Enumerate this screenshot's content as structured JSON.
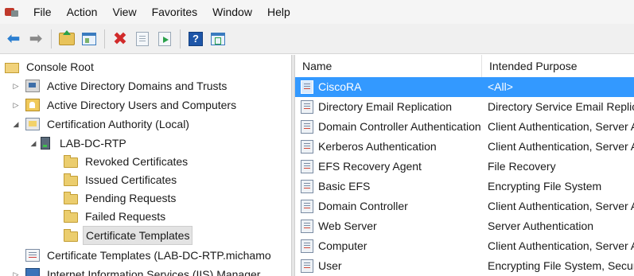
{
  "menu": [
    "File",
    "Action",
    "View",
    "Favorites",
    "Window",
    "Help"
  ],
  "toolbar": {
    "buttons": [
      "back-icon",
      "forward-icon",
      "up-folder-icon",
      "show-hide-tree-icon",
      "delete-icon",
      "properties-sheet-icon",
      "export-list-icon",
      "help-icon",
      "action-pane-icon"
    ],
    "help_glyph": "?"
  },
  "tree": {
    "items": [
      {
        "label": "Console Root",
        "icon": "folder-icon",
        "expander": ""
      },
      {
        "label": "Active Directory Domains and Trusts",
        "icon": "ad-domains-icon",
        "expander": "▷"
      },
      {
        "label": "Active Directory Users and Computers",
        "icon": "ad-users-icon",
        "expander": "▷"
      },
      {
        "label": "Certification Authority (Local)",
        "icon": "ca-icon",
        "expander": "◢"
      },
      {
        "label": "LAB-DC-RTP",
        "icon": "server-icon",
        "expander": "◢"
      },
      {
        "label": "Revoked Certificates",
        "icon": "folder-icon",
        "expander": ""
      },
      {
        "label": "Issued Certificates",
        "icon": "folder-icon",
        "expander": ""
      },
      {
        "label": "Pending Requests",
        "icon": "folder-icon",
        "expander": ""
      },
      {
        "label": "Failed Requests",
        "icon": "folder-icon",
        "expander": ""
      },
      {
        "label": "Certificate Templates",
        "icon": "folder-icon",
        "expander": ""
      },
      {
        "label": "Certificate Templates (LAB-DC-RTP.michamo",
        "icon": "cert-templates-icon",
        "expander": ""
      },
      {
        "label": "Internet Information Services (IIS) Manager",
        "icon": "iis-icon",
        "expander": "▷"
      }
    ],
    "selected": "Certificate Templates"
  },
  "list": {
    "columns": [
      "Name",
      "Intended Purpose"
    ],
    "rows": [
      {
        "name": "CiscoRA",
        "purpose": "<All>"
      },
      {
        "name": "Directory Email Replication",
        "purpose": "Directory Service Email Replication"
      },
      {
        "name": "Domain Controller Authentication",
        "purpose": "Client Authentication, Server Authentication"
      },
      {
        "name": "Kerberos Authentication",
        "purpose": "Client Authentication, Server Authentication"
      },
      {
        "name": "EFS Recovery Agent",
        "purpose": "File Recovery"
      },
      {
        "name": "Basic EFS",
        "purpose": "Encrypting File System"
      },
      {
        "name": "Domain Controller",
        "purpose": "Client Authentication, Server Authentication"
      },
      {
        "name": "Web Server",
        "purpose": "Server Authentication"
      },
      {
        "name": "Computer",
        "purpose": "Client Authentication, Server Authentication"
      },
      {
        "name": "User",
        "purpose": "Encrypting File System, Secure Email"
      }
    ],
    "selected_row": "CiscoRA"
  },
  "colors": {
    "selection": "#3399ff",
    "tree_selection": "#e3e3e3"
  }
}
